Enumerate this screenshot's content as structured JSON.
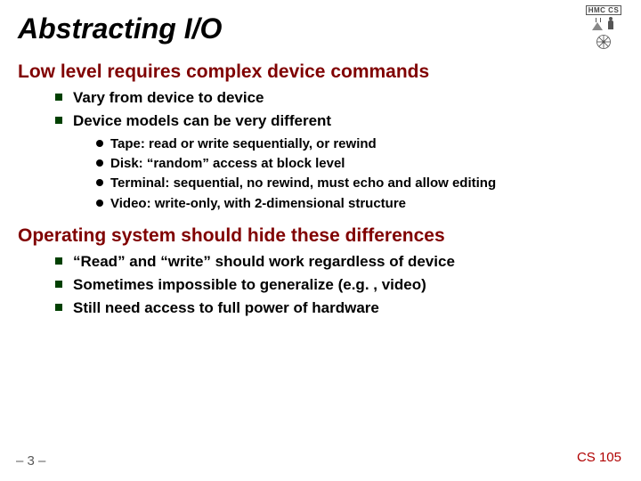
{
  "title": "Abstracting I/O",
  "sections": [
    {
      "heading": "Low level requires complex device commands",
      "items": [
        {
          "text": "Vary from device to device"
        },
        {
          "text": "Device models can be very different",
          "sub": [
            "Tape: read or write sequentially, or rewind",
            "Disk: “random” access at block level",
            "Terminal: sequential, no rewind, must echo and allow editing",
            "Video: write-only, with 2-dimensional structure"
          ]
        }
      ]
    },
    {
      "heading": "Operating system should hide these differences",
      "items": [
        {
          "text": "“Read” and “write” should work regardless of device"
        },
        {
          "text": "Sometimes impossible to generalize (e.g. , video)"
        },
        {
          "text": "Still need access to full power of hardware"
        }
      ]
    }
  ],
  "footer": {
    "left": "– 3 –",
    "right": "CS 105"
  },
  "logo": {
    "label": "HMC  CS"
  }
}
